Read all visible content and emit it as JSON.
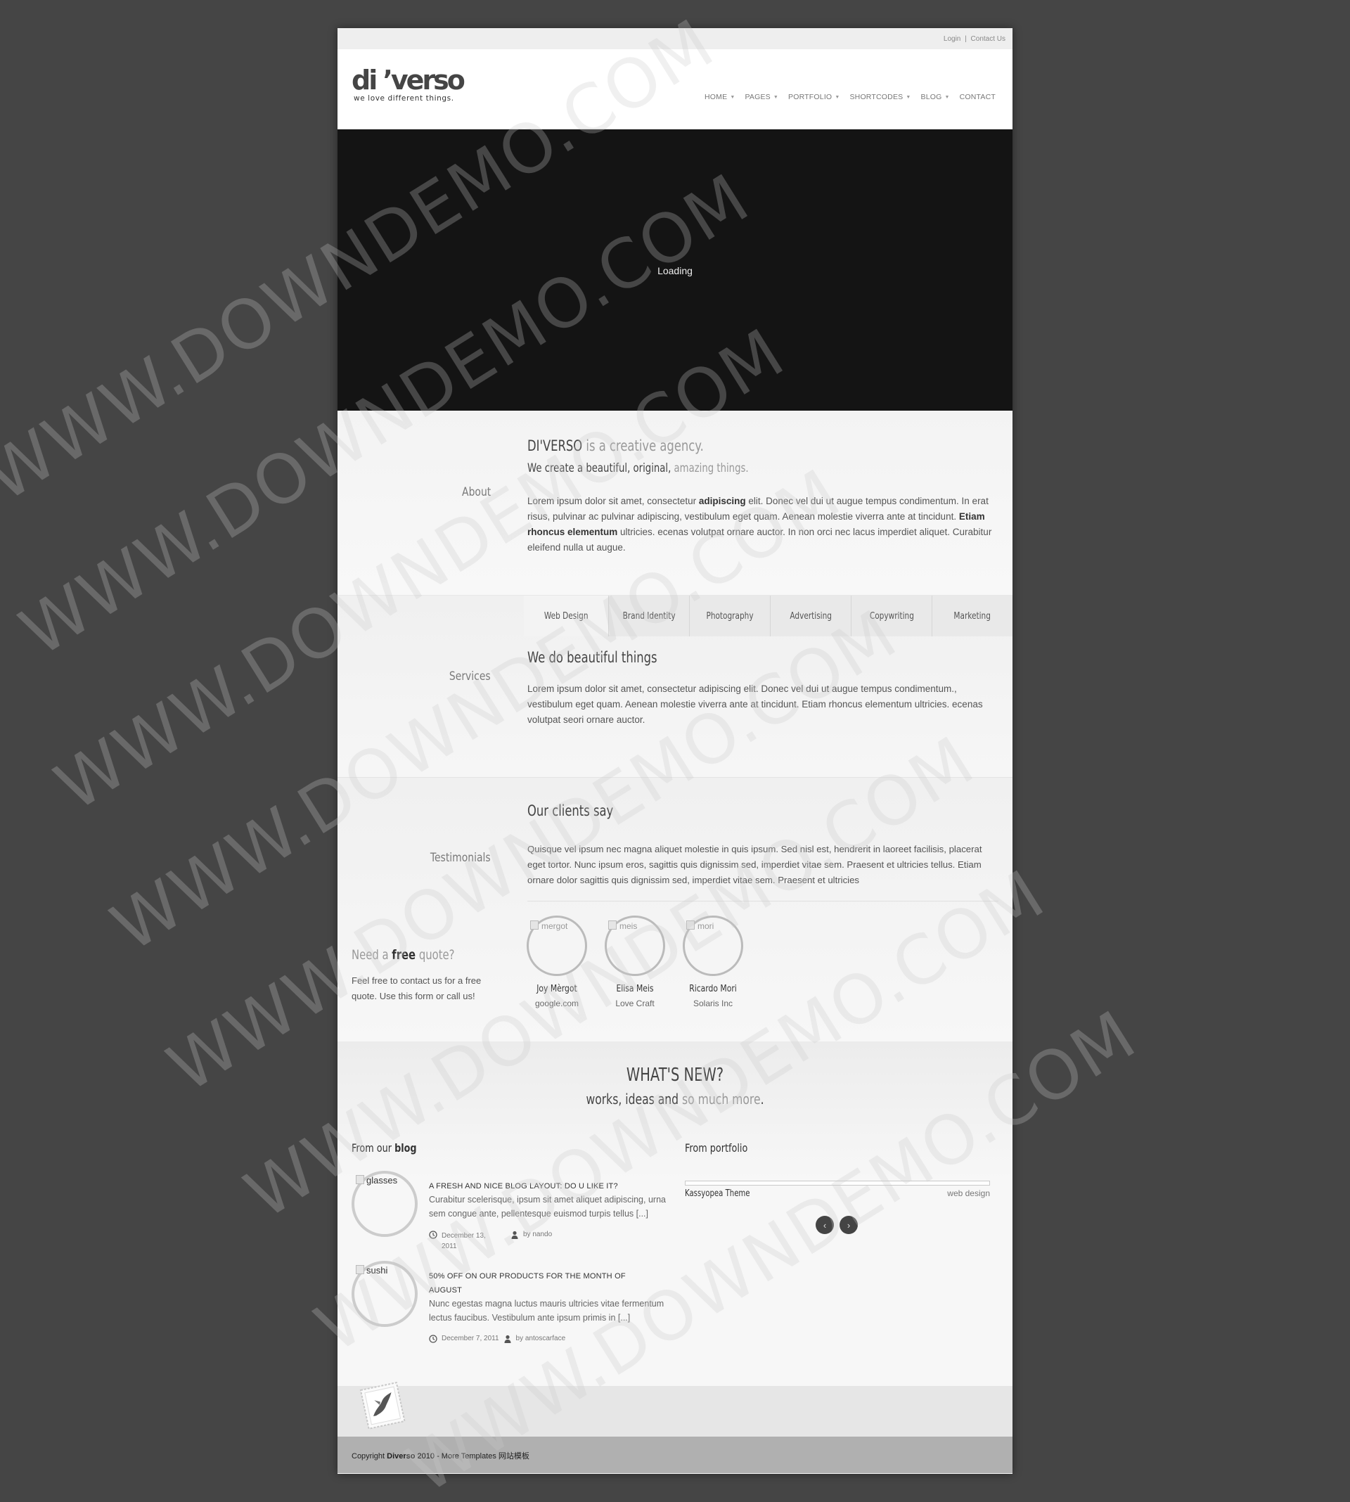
{
  "topbar": {
    "login": "Login",
    "separator": "|",
    "contact": "Contact Us"
  },
  "logo": {
    "name": "di ’verso",
    "tagline": "we love different things."
  },
  "nav": [
    {
      "label": "HOME",
      "has_dropdown": true
    },
    {
      "label": "PAGES",
      "has_dropdown": true
    },
    {
      "label": "PORTFOLIO",
      "has_dropdown": true
    },
    {
      "label": "SHORTCODES",
      "has_dropdown": true
    },
    {
      "label": "BLOG",
      "has_dropdown": true
    },
    {
      "label": "CONTACT",
      "has_dropdown": false
    }
  ],
  "slider": {
    "loading": "Loading"
  },
  "about": {
    "label": "About",
    "title_brand": "DI'VERSO",
    "title_rest": "is a creative agency.",
    "subtitle_dark": "We create a beautiful, original,",
    "subtitle_light": "amazing things.",
    "p1": "Lorem ipsum dolor sit amet, consectetur ",
    "p1_bold": "adipiscing",
    "p2": " elit. Donec vel dui ut augue tempus condimentum. In erat risus, pulvinar ac pulvinar adipiscing, vestibulum eget quam. Aenean molestie viverra ante at tincidunt. ",
    "p2_bold": "Etiam rhoncus elementum",
    "p3": " ultricies. ecenas volutpat ornare auctor. In non orci nec lacus imperdiet aliquet. Curabitur eleifend nulla ut augue."
  },
  "services": {
    "label": "Services",
    "tabs": [
      "Web Design",
      "Brand Identity",
      "Photography",
      "Advertising",
      "Copywriting",
      "Marketing"
    ],
    "heading": "We do beautiful things",
    "text": "Lorem ipsum dolor sit amet, consectetur adipiscing elit. Donec vel dui ut augue tempus condimentum., vestibulum eget quam. Aenean molestie viverra ante at tincidunt. Etiam rhoncus elementum ultricies. ecenas volutpat seori ornare auctor."
  },
  "testimonials": {
    "label": "Testimonials",
    "heading": "Our clients say",
    "text": "Quisque vel ipsum nec magna aliquet molestie in quis ipsum. Sed nisl est, hendrerit in laoreet facilisis, placerat eget tortor. Nunc ipsum eros, sagittis quis dignissim sed, imperdiet vitae sem. Praesent et ultricies tellus. Etiam ornare dolor sagittis quis dignissim sed, imperdiet vitae sem. Praesent et ultricies",
    "clients": [
      {
        "alt": "mergot",
        "name": "Joy Mèrgot",
        "company": "google.com"
      },
      {
        "alt": "meis",
        "name": "Elisa Meis",
        "company": "Love Craft"
      },
      {
        "alt": "mori",
        "name": "Ricardo Mori",
        "company": "Solaris Inc"
      }
    ],
    "quote_need": "Need a",
    "quote_free": "free",
    "quote_rest": "quote?",
    "quote_text": "Feel free to contact us for a free quote. Use this form or call us!"
  },
  "news": {
    "title": "WHAT'S NEW?",
    "sub_dark": "works, ideas and",
    "sub_light": "so much more",
    "sub_end": ".",
    "blog_title_a": "From our",
    "blog_title_b": "blog",
    "posts": [
      {
        "alt": "glasses",
        "title": "A FRESH AND NICE BLOG LAYOUT: DO U LIKE IT?",
        "excerpt": "Curabitur scelerisque, ipsum sit amet aliquet adipiscing, urna sem congue ante, pellentesque euismod turpis tellus [...]",
        "date": "December 13, 2011",
        "author": "by nando"
      },
      {
        "alt": "sushi",
        "title": "50% OFF ON OUR PRODUCTS FOR THE MONTH OF AUGUST",
        "excerpt": "Nunc egestas magna luctus mauris ultricies vitae fermentum lectus faucibus. Vestibulum ante ipsum primis in [...]",
        "date": "December 7, 2011",
        "author": "by antoscarface"
      }
    ],
    "portfolio_title": "From portfolio",
    "portfolio_item": "Kassyopea Theme",
    "portfolio_cat": "web design",
    "prev": "‹",
    "next": "›"
  },
  "footer": {
    "copy_a": "Copyright ",
    "copy_brand": "Diverso",
    "copy_b": " 2010 - More Templates 网站模板"
  },
  "watermark": "WWW.DOWNDEMO.COM"
}
